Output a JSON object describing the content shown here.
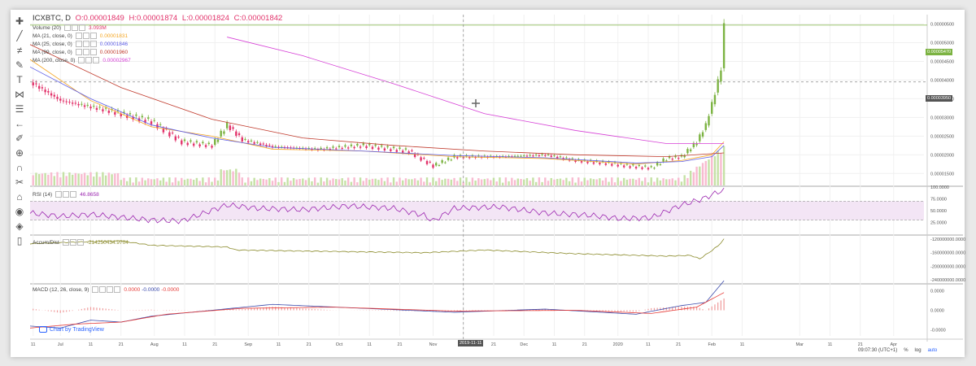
{
  "header": {
    "symbol": "ICXBTC, D",
    "o": "O:0.00001849",
    "h": "H:0.00001874",
    "l": "L:0.00001824",
    "c": "C:0.00001842"
  },
  "legends": [
    {
      "id": "vol",
      "label": "Volume (20)",
      "value": "3.093M",
      "color": "#e2336b"
    },
    {
      "id": "ma21",
      "label": "MA (21, close, 0)",
      "value": "0.00001831",
      "color": "#f5a623"
    },
    {
      "id": "ma25",
      "label": "MA (25, close, 0)",
      "value": "0.00001846",
      "color": "#5c5ce6"
    },
    {
      "id": "ma99",
      "label": "MA (99, close, 0)",
      "value": "0.00001960",
      "color": "#c0392b"
    },
    {
      "id": "ma200",
      "label": "MA (200, close, 0)",
      "value": "0.00002967",
      "color": "#d63fd6"
    }
  ],
  "rsi": {
    "label": "RSI (14)",
    "value": "46.8658"
  },
  "accum": {
    "label": "Accum/Dist",
    "value": "-214250434.9704"
  },
  "macd": {
    "label": "MACD (12, 26, close, 9)",
    "v1": "0.0000",
    "v2": "-0.0000",
    "v3": "-0.0000"
  },
  "watermark": "Chart by TradingView",
  "bottom": {
    "time": "09:07:30 (UTC+1)",
    "pct": "%",
    "log": "log",
    "auto": "auto"
  },
  "crosshair_date": "2019-11-11",
  "price_tags": {
    "last": "0.00005470",
    "cross": "0.00003950"
  },
  "chart_data": {
    "type": "line",
    "title": "ICXBTC, D",
    "price_axis": [
      "0.00000500",
      "0.00005000",
      "0.00004500",
      "0.00004000",
      "0.00003500",
      "0.00003000",
      "0.00002500",
      "0.00002000",
      "0.00001500"
    ],
    "price_ticks": [
      5.5e-05,
      5e-05,
      4.5e-05,
      4e-05,
      3.5e-05,
      3e-05,
      2.5e-05,
      2e-05,
      1.5e-05
    ],
    "ylim": [
      1.18e-05,
      5.75e-05
    ],
    "rsi_axis": [
      "100.0000",
      "75.0000",
      "50.0000",
      "25.0000"
    ],
    "rsi_ticks": [
      100,
      75,
      50,
      25
    ],
    "accum_axis": [
      "-120000000.0000",
      "-160000000.0000",
      "-200000000.0000",
      "-240000000.0000"
    ],
    "accum_ticks": [
      -120000000,
      -160000000,
      -200000000,
      -240000000
    ],
    "accum_ylim": [
      -250000000,
      -110000000
    ],
    "macd_axis": [
      "0.0000",
      "0.0000",
      "-0.0000"
    ],
    "macd_ticks": [
      5e-06,
      0,
      -5e-06
    ],
    "macd_ylim": [
      -6.5e-06,
      6.5e-06
    ],
    "x_labels": [
      "11",
      "Jul",
      "11",
      "21",
      "Aug",
      "11",
      "21",
      "Sep",
      "11",
      "21",
      "Oct",
      "11",
      "21",
      "Nov",
      "2019-11-11",
      "21",
      "Dec",
      "11",
      "21",
      "2020",
      "11",
      "21",
      "Feb",
      "11",
      "Mar",
      "11",
      "21",
      "Apr"
    ],
    "x_label_days": [
      -9,
      0,
      10,
      20,
      31,
      41,
      51,
      62,
      72,
      82,
      92,
      102,
      112,
      123,
      133,
      143,
      153,
      163,
      173,
      184,
      194,
      204,
      215,
      225,
      244,
      254,
      264,
      275
    ],
    "x_range_days": [
      -10,
      285
    ],
    "last_day": 219,
    "series": [
      {
        "name": "ICXBTC",
        "values": [
          [
            -10,
            3.95e-05
          ],
          [
            0,
            3.45e-05
          ],
          [
            15,
            3.2e-05
          ],
          [
            30,
            2.9e-05
          ],
          [
            40,
            2.35e-05
          ],
          [
            50,
            2.25e-05
          ],
          [
            55,
            2.8e-05
          ],
          [
            60,
            2.4e-05
          ],
          [
            70,
            2.22e-05
          ],
          [
            85,
            2.15e-05
          ],
          [
            100,
            2.25e-05
          ],
          [
            115,
            2.1e-05
          ],
          [
            123,
            1.7e-05
          ],
          [
            130,
            1.95e-05
          ],
          [
            145,
            1.95e-05
          ],
          [
            160,
            2e-05
          ],
          [
            170,
            1.85e-05
          ],
          [
            180,
            1.78e-05
          ],
          [
            188,
            1.7e-05
          ],
          [
            195,
            1.65e-05
          ],
          [
            200,
            1.9e-05
          ],
          [
            205,
            1.95e-05
          ],
          [
            210,
            2.35e-05
          ],
          [
            213,
            2.8e-05
          ],
          [
            216,
            3.65e-05
          ],
          [
            218,
            4.3e-05
          ],
          [
            219,
            5.47e-05
          ]
        ]
      },
      {
        "name": "MA (21, close, 0)",
        "values": [
          [
            -10,
            4.55e-05
          ],
          [
            10,
            3.45e-05
          ],
          [
            30,
            2.75e-05
          ],
          [
            50,
            2.5e-05
          ],
          [
            70,
            2.15e-05
          ],
          [
            100,
            2.1e-05
          ],
          [
            130,
            1.95e-05
          ],
          [
            160,
            1.9e-05
          ],
          [
            190,
            1.75e-05
          ],
          [
            205,
            1.85e-05
          ],
          [
            215,
            2e-05
          ],
          [
            219,
            2.35e-05
          ]
        ]
      },
      {
        "name": "MA (25, close, 0)",
        "values": [
          [
            -10,
            4.35e-05
          ],
          [
            10,
            3.5e-05
          ],
          [
            30,
            2.8e-05
          ],
          [
            50,
            2.45e-05
          ],
          [
            70,
            2.2e-05
          ],
          [
            100,
            2.1e-05
          ],
          [
            130,
            1.98e-05
          ],
          [
            160,
            1.92e-05
          ],
          [
            190,
            1.78e-05
          ],
          [
            205,
            1.82e-05
          ],
          [
            215,
            1.95e-05
          ],
          [
            219,
            2.25e-05
          ]
        ]
      },
      {
        "name": "MA (99, close, 0)",
        "values": [
          [
            -10,
            4.95e-05
          ],
          [
            20,
            3.8e-05
          ],
          [
            50,
            2.95e-05
          ],
          [
            80,
            2.45e-05
          ],
          [
            110,
            2.25e-05
          ],
          [
            140,
            2.1e-05
          ],
          [
            170,
            2e-05
          ],
          [
            200,
            1.95e-05
          ],
          [
            219,
            2.05e-05
          ]
        ]
      },
      {
        "name": "MA (200, close, 0)",
        "values": [
          [
            55,
            5.15e-05
          ],
          [
            80,
            4.65e-05
          ],
          [
            110,
            3.9e-05
          ],
          [
            140,
            3.1e-05
          ],
          [
            170,
            2.65e-05
          ],
          [
            200,
            2.3e-05
          ],
          [
            219,
            2.3e-05
          ]
        ]
      }
    ],
    "rsi_values": [
      [
        -10,
        45
      ],
      [
        0,
        38
      ],
      [
        10,
        42
      ],
      [
        20,
        36
      ],
      [
        30,
        30
      ],
      [
        40,
        28
      ],
      [
        55,
        62
      ],
      [
        65,
        55
      ],
      [
        80,
        52
      ],
      [
        95,
        60
      ],
      [
        110,
        55
      ],
      [
        120,
        40
      ],
      [
        123,
        28
      ],
      [
        130,
        55
      ],
      [
        145,
        58
      ],
      [
        160,
        45
      ],
      [
        175,
        40
      ],
      [
        185,
        33
      ],
      [
        195,
        35
      ],
      [
        205,
        62
      ],
      [
        212,
        75
      ],
      [
        218,
        92
      ],
      [
        219,
        95
      ]
    ],
    "accum_values": [
      [
        -10,
        -133000000
      ],
      [
        10,
        -127000000
      ],
      [
        20,
        -125000000
      ],
      [
        30,
        -138000000
      ],
      [
        55,
        -143000000
      ],
      [
        58,
        -152000000
      ],
      [
        80,
        -155000000
      ],
      [
        120,
        -160000000
      ],
      [
        140,
        -152000000
      ],
      [
        170,
        -163000000
      ],
      [
        200,
        -170000000
      ],
      [
        208,
        -168000000
      ],
      [
        211,
        -178000000
      ],
      [
        214,
        -160000000
      ],
      [
        217,
        -140000000
      ],
      [
        219,
        -120000000
      ]
    ],
    "macd_values": [
      [
        -10,
        -4e-06
      ],
      [
        0,
        -4.5e-06
      ],
      [
        10,
        -2.5e-06
      ],
      [
        20,
        -3e-06
      ],
      [
        30,
        -1.5e-06
      ],
      [
        50,
        0
      ],
      [
        70,
        1.5e-06
      ],
      [
        100,
        5e-07
      ],
      [
        130,
        -5e-07
      ],
      [
        160,
        3e-07
      ],
      [
        190,
        -1e-06
      ],
      [
        205,
        1.2e-06
      ],
      [
        213,
        2e-06
      ],
      [
        219,
        7.5e-06
      ]
    ],
    "signal_values": [
      [
        -10,
        -4.5e-06
      ],
      [
        5,
        -3.5e-06
      ],
      [
        20,
        -3e-06
      ],
      [
        35,
        -1e-06
      ],
      [
        60,
        5e-07
      ],
      [
        90,
        8e-07
      ],
      [
        130,
        -2e-07
      ],
      [
        170,
        0
      ],
      [
        195,
        -8e-07
      ],
      [
        210,
        8e-07
      ],
      [
        219,
        4.5e-06
      ]
    ]
  }
}
